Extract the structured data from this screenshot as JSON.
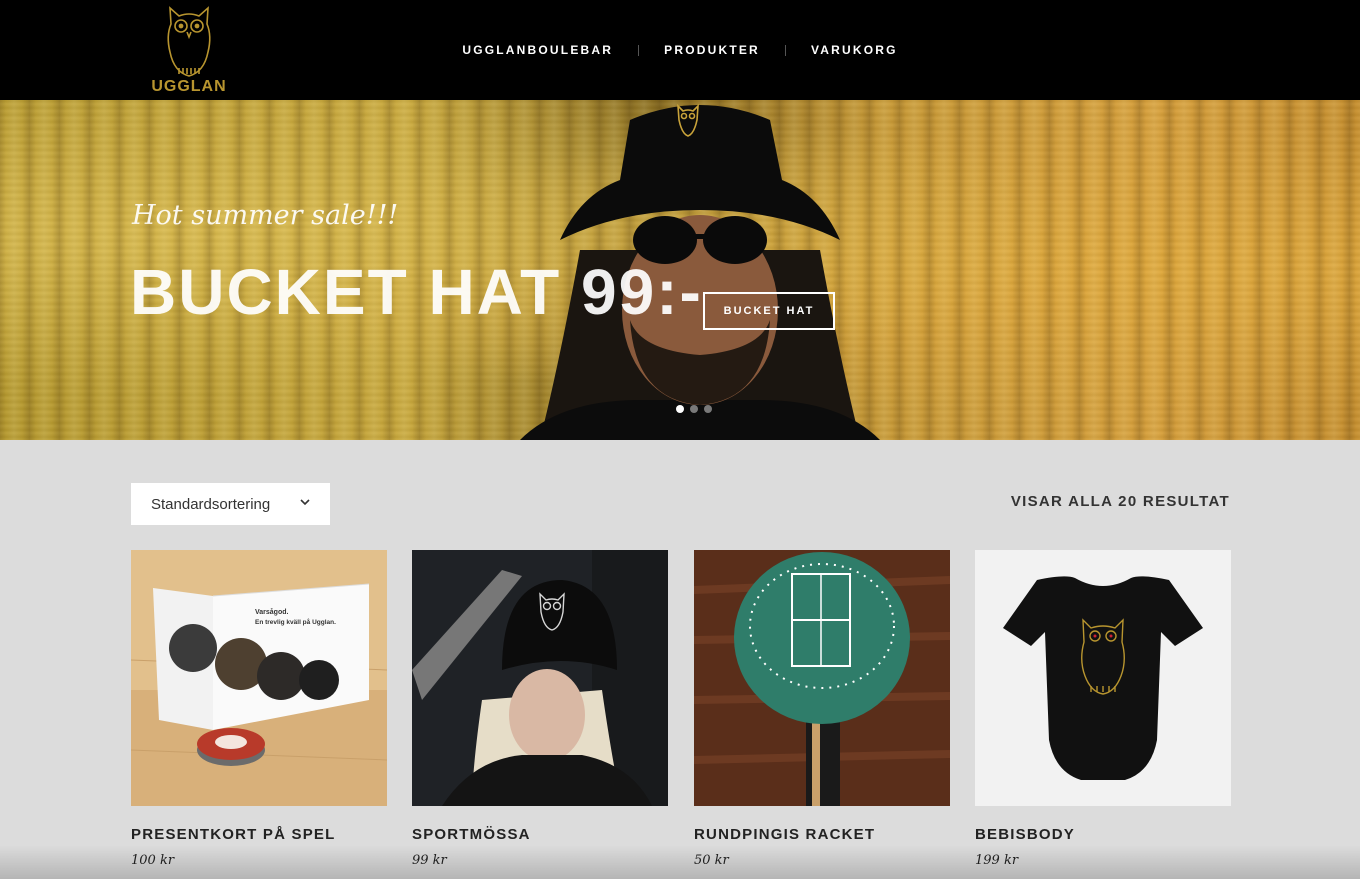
{
  "brand": {
    "name": "UGGLAN",
    "accent_color": "#b8952f"
  },
  "nav": {
    "items": [
      {
        "label": "UGGLANBOULEBAR"
      },
      {
        "label": "PRODUKTER"
      },
      {
        "label": "VARUKORG"
      }
    ]
  },
  "hero": {
    "tagline": "Hot summer sale!!!",
    "title": "BUCKET HAT 99:-",
    "button_label": "BUCKET HAT",
    "slides_total": 3,
    "active_slide": 1
  },
  "shop": {
    "sort_label": "Standardsortering",
    "results_label": "VISAR ALLA 20 RESULTAT",
    "products": [
      {
        "name": "PRESENTKORT PÅ SPEL",
        "price": "100 kr",
        "card_line1": "Varsågod.",
        "card_line2": "En trevlig kväll på Ugglan."
      },
      {
        "name": "SPORTMÖSSA",
        "price": "99 kr"
      },
      {
        "name": "RUNDPINGIS RACKET",
        "price": "50 kr"
      },
      {
        "name": "BEBISBODY",
        "price": "199 kr"
      }
    ]
  }
}
